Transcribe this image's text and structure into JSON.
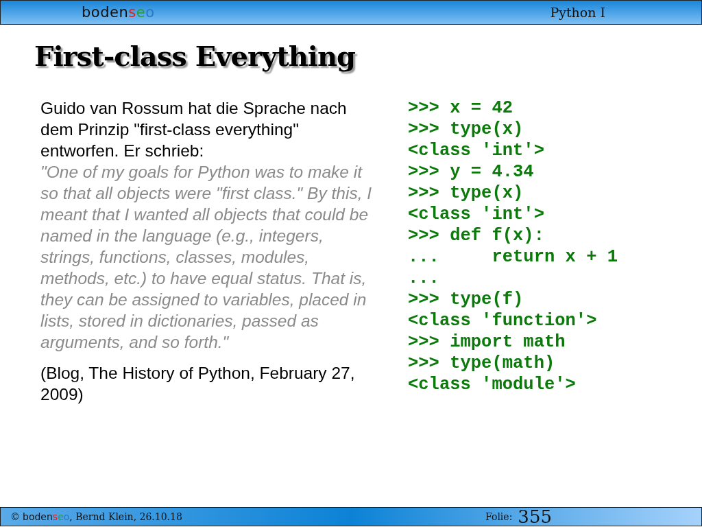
{
  "header": {
    "logo": [
      {
        "text": "boden",
        "color": "#111111"
      },
      {
        "text": "s",
        "color": "#e0201b"
      },
      {
        "text": "e",
        "color": "#2a9d3a"
      },
      {
        "text": "o",
        "color": "#2b78c2"
      }
    ],
    "course": "Python I"
  },
  "title": "First-class Everything",
  "text": {
    "intro": "Guido van Rossum hat die Sprache nach dem Prinzip \"first-class everything\" entworfen.  Er schrieb:",
    "quote": "\"One of my goals for Python was to make it so that all objects were \"first class.\" By this, I meant that I wanted all objects that could be named in the language (e.g., integers, strings, functions, classes, modules, methods, etc.) to have equal status. That is, they can be assigned to variables, placed in lists, stored in dictionaries, passed as arguments, and so forth.\"",
    "source": "(Blog, The History of Python, February 27, 2009)"
  },
  "code": [
    ">>> x = 42",
    ">>> type(x)",
    "<class 'int'>",
    ">>> y = 4.34",
    ">>> type(x)",
    "<class 'int'>",
    ">>> def f(x):",
    "...     return x + 1",
    "...",
    ">>> type(f)",
    "<class 'function'>",
    ">>> import math",
    ">>> type(math)",
    "<class 'module'>"
  ],
  "footer": {
    "copyright": "©",
    "logo": [
      {
        "text": "boden",
        "color": "#111111"
      },
      {
        "text": "s",
        "color": "#e0201b"
      },
      {
        "text": "e",
        "color": "#2a9d3a"
      },
      {
        "text": "o",
        "color": "#2b78c2"
      }
    ],
    "author": ", Bernd Klein, 26.10.18",
    "slide_label": "Folie:",
    "slide_number": "355"
  }
}
